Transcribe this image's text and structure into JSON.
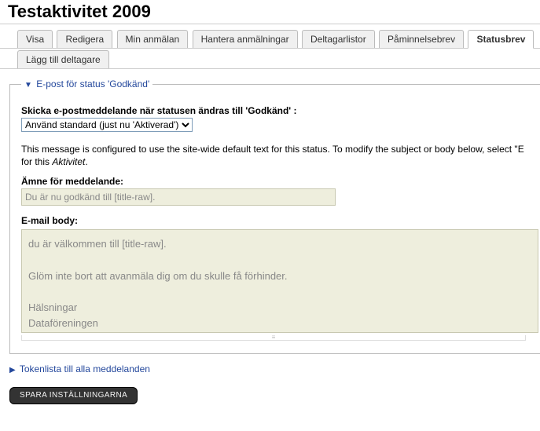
{
  "page_title": "Testaktivitet 2009",
  "tabs_row1": [
    {
      "label": "Visa",
      "active": false
    },
    {
      "label": "Redigera",
      "active": false
    },
    {
      "label": "Min anmälan",
      "active": false
    },
    {
      "label": "Hantera anmälningar",
      "active": false
    },
    {
      "label": "Deltagarlistor",
      "active": false
    },
    {
      "label": "Påminnelsebrev",
      "active": false
    },
    {
      "label": "Statusbrev",
      "active": true
    }
  ],
  "tabs_row2": [
    {
      "label": "Lägg till deltagare",
      "active": false
    }
  ],
  "fieldset1": {
    "legend": "E-post för status 'Godkänd'",
    "send_label": "Skicka e-postmeddelande när statusen ändras till 'Godkänd' :",
    "select_value": "Använd standard (just nu 'Aktiverad')",
    "info_prefix": "This message is configured to use the site-wide default text for this status. To modify the subject or body below, select \"E",
    "info_suffix_prefix": "for this ",
    "info_em": "Aktivitet",
    "info_suffix_end": ".",
    "subject_label": "Ämne för meddelande:",
    "subject_value": "Du är nu godkänd till [title-raw].",
    "body_label": "E-mail body:",
    "body_value": "du är välkommen till [title-raw].\n\nGlöm inte bort att avanmäla dig om du skulle få förhinder.\n\nHälsningar\nDataföreningen"
  },
  "fieldset2": {
    "legend": "Tokenlista till alla meddelanden"
  },
  "save_button": "SPARA INSTÄLLNINGARNA"
}
